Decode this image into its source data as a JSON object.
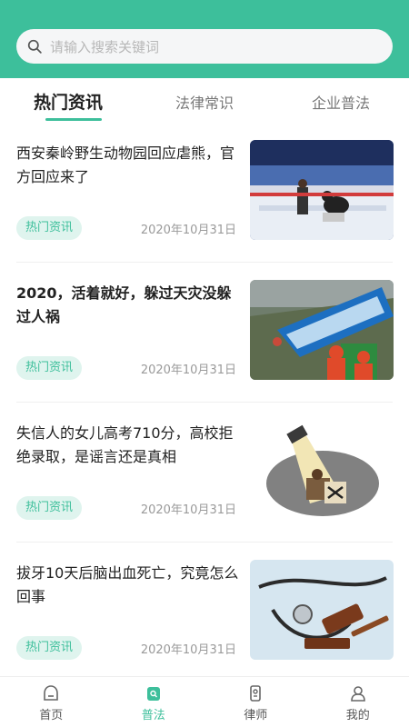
{
  "search": {
    "placeholder": "请输入搜索关键词"
  },
  "tabs": [
    {
      "label": "热门资讯",
      "active": true
    },
    {
      "label": "法律常识",
      "active": false
    },
    {
      "label": "企业普法",
      "active": false
    }
  ],
  "articles": [
    {
      "title": "西安秦岭野生动物园回应虐熊，官方回应来了",
      "tag": "热门资讯",
      "date": "2020年10月31日",
      "image_icon": "bear-show-photo"
    },
    {
      "title": "2020，活着就好，躲过天灾没躲过人祸",
      "tag": "热门资讯",
      "date": "2020年10月31日",
      "image_icon": "bus-in-water-photo"
    },
    {
      "title": "失信人的女儿高考710分，高校拒绝录取，是谣言还是真相",
      "tag": "热门资讯",
      "date": "2020年10月31日",
      "image_icon": "spotlight-illustration"
    },
    {
      "title": "拔牙10天后脑出血死亡，究竟怎么回事",
      "tag": "热门资讯",
      "date": "2020年10月31日",
      "image_icon": "stethoscope-gavel-photo"
    }
  ],
  "bottom_nav": [
    {
      "label": "首页",
      "icon": "home-icon",
      "active": false
    },
    {
      "label": "普法",
      "icon": "law-icon",
      "active": true
    },
    {
      "label": "律师",
      "icon": "lawyer-icon",
      "active": false
    },
    {
      "label": "我的",
      "icon": "profile-icon",
      "active": false
    }
  ],
  "colors": {
    "accent": "#3dbf9b",
    "tag_bg": "#dff4ee",
    "search_bg": "#f5f6f7"
  }
}
